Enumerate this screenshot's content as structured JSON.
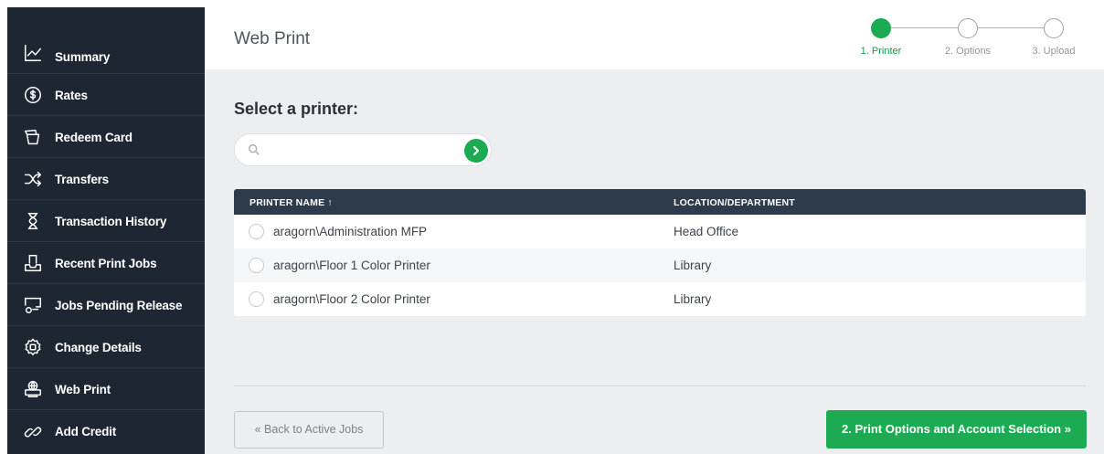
{
  "sidebar": {
    "items": [
      {
        "label": "Summary",
        "icon": "chart-line-icon"
      },
      {
        "label": "Rates",
        "icon": "dollar-circle-icon"
      },
      {
        "label": "Redeem Card",
        "icon": "cards-icon"
      },
      {
        "label": "Transfers",
        "icon": "shuffle-icon"
      },
      {
        "label": "Transaction History",
        "icon": "hourglass-icon"
      },
      {
        "label": "Recent Print Jobs",
        "icon": "inbox-tray-icon"
      },
      {
        "label": "Jobs Pending Release",
        "icon": "pending-release-icon"
      },
      {
        "label": "Change Details",
        "icon": "settings-gear-icon"
      },
      {
        "label": "Web Print",
        "icon": "printer-globe-icon"
      },
      {
        "label": "Add Credit",
        "icon": "link-chain-icon"
      }
    ]
  },
  "header": {
    "title": "Web Print",
    "steps": [
      {
        "label": "1. Printer",
        "active": true
      },
      {
        "label": "2. Options",
        "active": false
      },
      {
        "label": "3. Upload",
        "active": false
      }
    ]
  },
  "main": {
    "section_title": "Select a printer:",
    "search": {
      "value": "",
      "placeholder": ""
    },
    "table": {
      "columns": [
        "PRINTER NAME ↑",
        "LOCATION/DEPARTMENT"
      ],
      "rows": [
        {
          "name": "aragorn\\Administration MFP",
          "location": "Head Office"
        },
        {
          "name": "aragorn\\Floor 1 Color Printer",
          "location": "Library"
        },
        {
          "name": "aragorn\\Floor 2 Color Printer",
          "location": "Library"
        }
      ]
    },
    "back_button": "« Back to Active Jobs",
    "next_button": "2. Print Options and Account Selection »"
  },
  "colors": {
    "sidebar_bg": "#1d2733",
    "accent_green": "#1caa52",
    "table_header_bg": "#2d3b4a",
    "content_bg": "#eceef0"
  }
}
